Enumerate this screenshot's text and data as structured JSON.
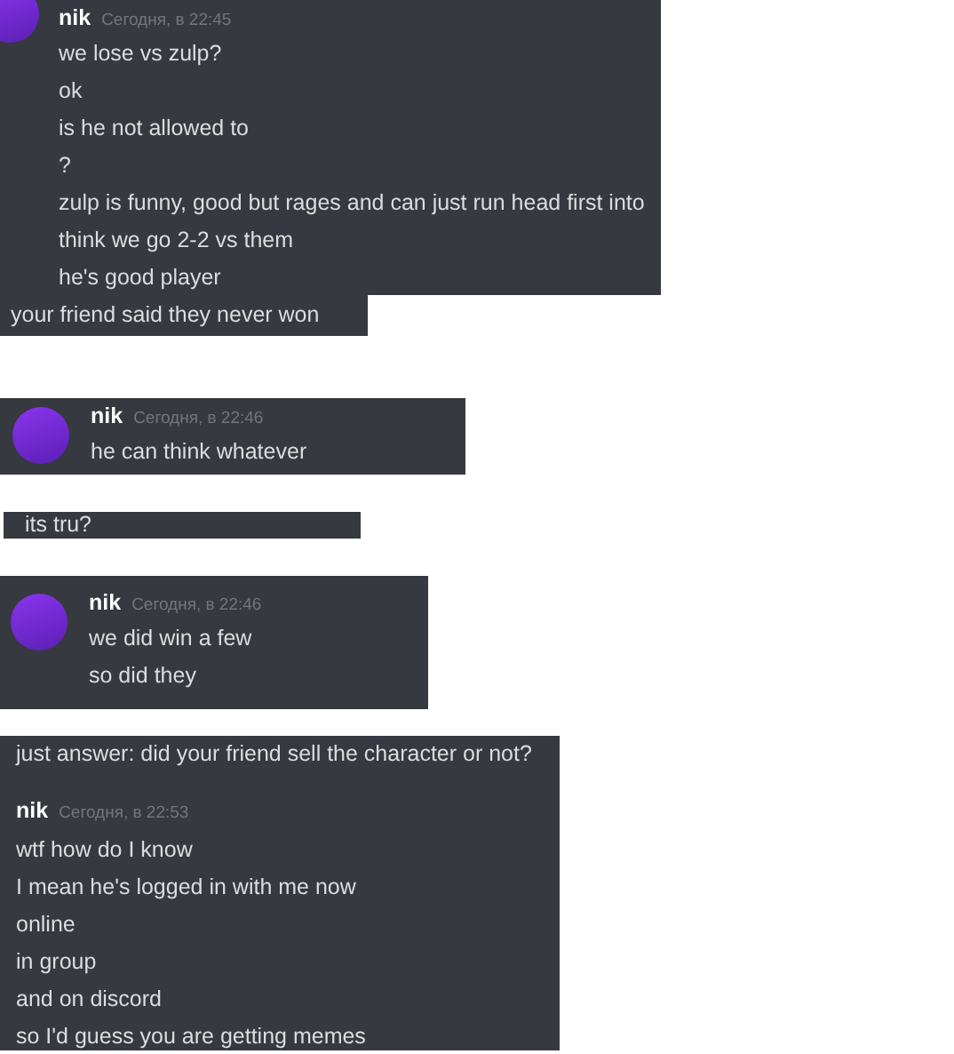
{
  "snippets": [
    {
      "items": [
        {
          "kind": "header",
          "author": "nik",
          "time": "Сегодня, в 22:45",
          "avatar": true
        },
        {
          "kind": "line",
          "text": "we lose vs zulp?"
        },
        {
          "kind": "line",
          "text": "ok"
        },
        {
          "kind": "line",
          "text": "is he not allowed to"
        },
        {
          "kind": "line",
          "text": "?"
        },
        {
          "kind": "line",
          "text": "zulp is funny, good but rages and can just run head first into"
        },
        {
          "kind": "line",
          "text": "think we go 2-2 vs them"
        },
        {
          "kind": "line",
          "text": "he's good player"
        }
      ]
    },
    {
      "items": [
        {
          "kind": "line",
          "text": "your friend said they never won"
        }
      ]
    },
    {
      "items": [
        {
          "kind": "header",
          "author": "nik",
          "time": "Сегодня, в 22:46",
          "avatar": true
        },
        {
          "kind": "line",
          "text": "he can think whatever"
        }
      ]
    },
    {
      "items": [
        {
          "kind": "line",
          "text": "its tru?"
        }
      ]
    },
    {
      "items": [
        {
          "kind": "header",
          "author": "nik",
          "time": "Сегодня, в 22:46",
          "avatar": true
        },
        {
          "kind": "line",
          "text": "we did win a few"
        },
        {
          "kind": "line",
          "text": "so did they"
        }
      ]
    },
    {
      "items": [
        {
          "kind": "line",
          "text": "just answer: did your friend sell the character or not?"
        },
        {
          "kind": "header",
          "author": "nik",
          "time": "Сегодня, в 22:53",
          "avatar": false
        },
        {
          "kind": "line",
          "text": "wtf how do I know"
        },
        {
          "kind": "line",
          "text": "I mean he's logged in with me now"
        },
        {
          "kind": "line",
          "text": "online"
        },
        {
          "kind": "line",
          "text": "in group"
        },
        {
          "kind": "line",
          "text": "and on discord"
        },
        {
          "kind": "line",
          "text": "so I'd guess you are getting memes"
        }
      ]
    }
  ]
}
